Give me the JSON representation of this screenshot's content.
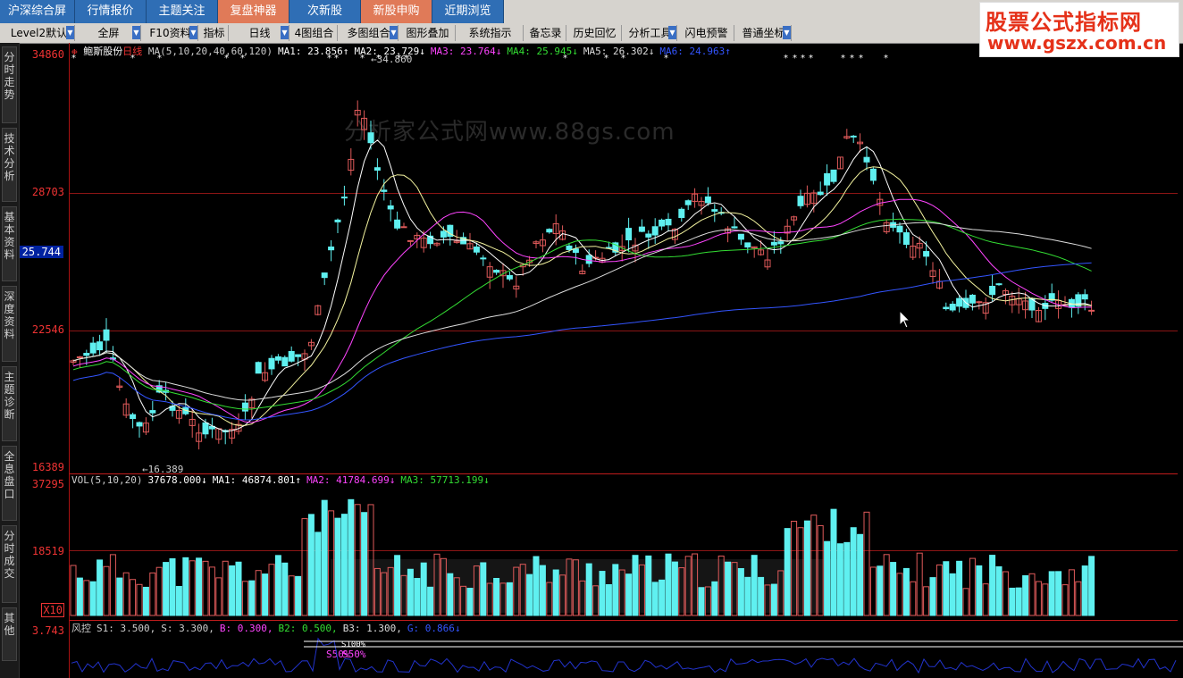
{
  "top_tabs": [
    {
      "label": "沪深综合屏",
      "hot": false
    },
    {
      "label": "行情报价",
      "hot": false
    },
    {
      "label": "主题关注",
      "hot": false
    },
    {
      "label": "复盘神器",
      "hot": true
    },
    {
      "label": "次新股",
      "hot": false
    },
    {
      "label": "新股申购",
      "hot": true
    },
    {
      "label": "近期浏览",
      "hot": false
    }
  ],
  "logo": {
    "title": "股票公式指标网",
    "url": "www.gszx.com.cn"
  },
  "toolbar": [
    "Level2默认",
    "全屏",
    "F10资料",
    "指标",
    "日线",
    "4图组合",
    "多图组合",
    "图形叠加",
    "系统指示",
    "备忘录",
    "历史回忆",
    "分析工具",
    "闪电预警",
    "普通坐标"
  ],
  "side_tabs": [
    "分时走势",
    "技术分析",
    "基本资料",
    "深度资料",
    "主题诊断",
    "全息盘口",
    "分时成交",
    "其他"
  ],
  "price_panel": {
    "stock_name": "鲍斯股份",
    "period": "日线",
    "ma_legend": [
      {
        "text": "MA(5,10,20,40,60,120)",
        "color": "#cccccc"
      },
      {
        "text": "MA1: 23.856↑",
        "color": "#ffffff"
      },
      {
        "text": "MA2: 23.729↓",
        "color": "#ffffff"
      },
      {
        "text": "MA3: 23.764↓",
        "color": "#ff44ff"
      },
      {
        "text": "MA4: 25.945↓",
        "color": "#33dd33"
      },
      {
        "text": "MA5: 26.302↓",
        "color": "#dddddd"
      },
      {
        "text": "MA6: 24.963↑",
        "color": "#3355ff"
      }
    ],
    "y_labels": [
      "34860",
      "28703",
      "22546",
      "16389"
    ],
    "current_price": "25.744",
    "high_marker": "34.860",
    "low_marker": "16.389",
    "watermark": "分析家公式网www.88gs.com"
  },
  "volume_panel": {
    "legend": [
      {
        "text": "VOL(5,10,20)",
        "color": "#cccccc"
      },
      {
        "text": "37678.000↓",
        "color": "#ffffff"
      },
      {
        "text": "MA1: 46874.801↑",
        "color": "#ffffff"
      },
      {
        "text": "MA2: 41784.699↓",
        "color": "#ff44ff"
      },
      {
        "text": "MA3: 57713.199↓",
        "color": "#33dd33"
      }
    ],
    "y_labels": [
      "37295",
      "18519"
    ],
    "unit": "X10"
  },
  "risk_panel": {
    "legend": [
      {
        "text": "风控",
        "color": "#cccccc"
      },
      {
        "text": "S1: 3.500,",
        "color": "#cccccc"
      },
      {
        "text": "S: 3.300,",
        "color": "#cccccc"
      },
      {
        "text": "B: 0.300,",
        "color": "#ff44ff"
      },
      {
        "text": "B2: 0.500,",
        "color": "#33dd33"
      },
      {
        "text": "B3: 1.300,",
        "color": "#dddddd"
      },
      {
        "text": "G: 0.866↓",
        "color": "#3355ff"
      }
    ],
    "y_label": "3.743",
    "marks": [
      "S100%",
      "S50%",
      "S50%"
    ]
  },
  "colors": {
    "up": "#e05a5a",
    "down": "#5ff0f0",
    "grid": "#8b1515"
  }
}
